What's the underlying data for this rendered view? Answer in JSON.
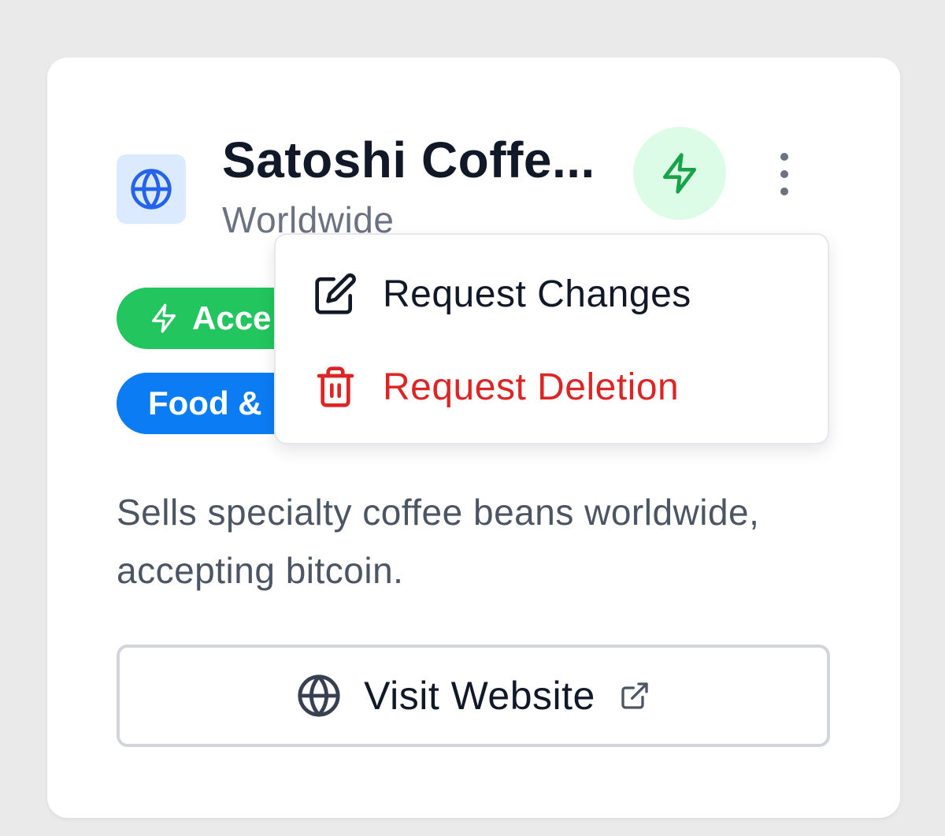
{
  "listing": {
    "title": "Satoshi Coffe...",
    "location": "Worldwide",
    "description": "Sells specialty coffee beans worldwide, accepting bitcoin.",
    "tags": [
      {
        "label": "Acce",
        "color": "#22c55e",
        "icon": "lightning-icon"
      },
      {
        "label": "Food &",
        "color": "#0b7cf3"
      }
    ],
    "visit_button_label": "Visit Website"
  },
  "menu": {
    "items": [
      {
        "label": "Request Changes",
        "icon": "edit-icon",
        "color": "#111827"
      },
      {
        "label": "Request Deletion",
        "icon": "trash-icon",
        "color": "#dc2626"
      }
    ]
  },
  "colors": {
    "accent_green": "#22c55e",
    "accent_blue": "#0b7cf3",
    "danger": "#dc2626",
    "globe_blue": "#2563eb",
    "lightning_green": "#16a34a"
  }
}
